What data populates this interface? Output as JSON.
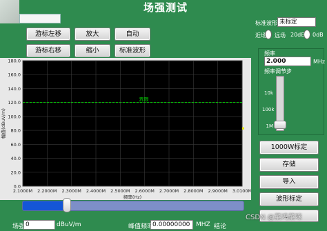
{
  "header": {
    "title": "场强测试"
  },
  "toolbar": {
    "cursor_left": "游标左移",
    "zoom_in": "放大",
    "auto": "自动",
    "cursor_right": "游标右移",
    "zoom_out": "缩小",
    "std_waveform": "标准波形"
  },
  "chart_data": {
    "type": "line",
    "ylabel": "幅值(dBuV/m)",
    "xlabel": "频率(Hz)",
    "ylim": [
      0,
      180
    ],
    "xlim": [
      2.1,
      3.01
    ],
    "yticks": [
      "180.0",
      "160.0",
      "140.0",
      "120.0",
      "100.0",
      "80.0",
      "60.0",
      "40.0",
      "20.0",
      "0.0"
    ],
    "xticks": [
      "2.1000M",
      "2.2000M",
      "2.3000M",
      "2.4000M",
      "2.5000M",
      "2.6000M",
      "2.7000M",
      "2.8000M",
      "2.9000M",
      "3.0100M"
    ],
    "limit_line": {
      "name": "界限",
      "value": 120,
      "color": "#00d000"
    },
    "background": "#000000"
  },
  "slider": {
    "value_fraction": 0.2
  },
  "bottom": {
    "field_label": "场强",
    "field_value": "0",
    "field_unit": "dBuV/m",
    "peak_label": "峰值频率",
    "peak_value": "0.00000000",
    "peak_unit": "MHZ",
    "result_label": "结论"
  },
  "right": {
    "std_label": "标准波形",
    "std_value": "未标定",
    "toggle_left_label": "近场",
    "toggle_mid_label": "远场",
    "toggle_mid_value": "20dB",
    "toggle_right_label": "0dB",
    "freq_label": "频率",
    "freq_value": "2.000",
    "freq_unit": "MHz",
    "step_label": "频率调节步",
    "step_ticks": [
      "10k",
      "100k",
      "1M"
    ]
  },
  "actions": {
    "calibrate_1000w": "1000W标定",
    "save": "存储",
    "import": "导入",
    "waveform_calibrate": "波形标定",
    "last_partial": "..."
  },
  "watermark": "CSDN @菜鸡菜咪"
}
